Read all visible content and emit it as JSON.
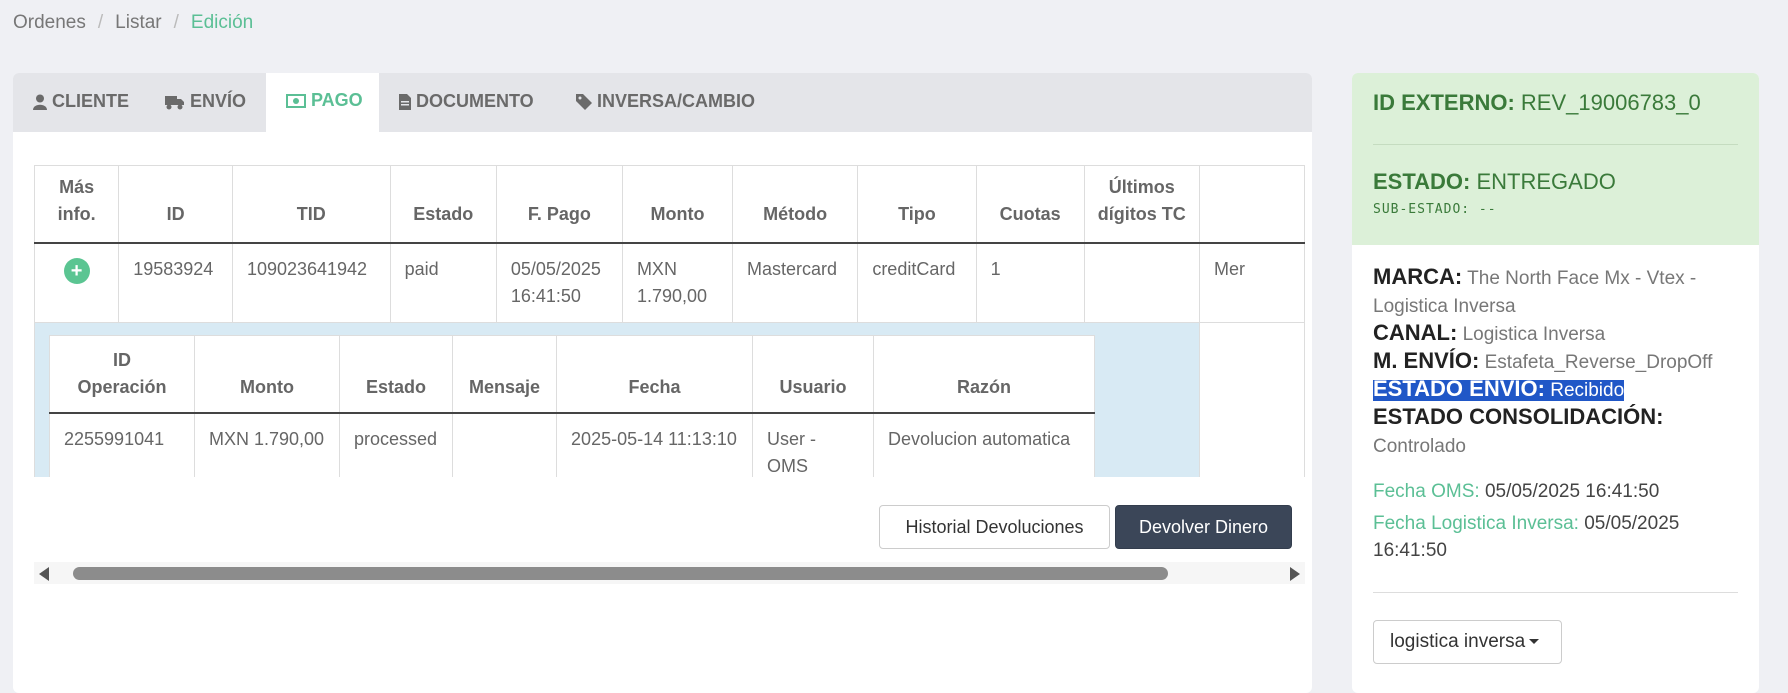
{
  "breadcrumb": {
    "items": [
      "Ordenes",
      "Listar"
    ],
    "active": "Edición"
  },
  "tabs": [
    {
      "label": "CLIENTE",
      "icon": "user-icon"
    },
    {
      "label": "ENVÍO",
      "icon": "truck-icon"
    },
    {
      "label": "PAGO",
      "icon": "money-icon",
      "active": true
    },
    {
      "label": "DOCUMENTO",
      "icon": "file-icon"
    },
    {
      "label": "INVERSA/CAMBIO",
      "icon": "tag-icon"
    }
  ],
  "payments_table": {
    "headers": [
      "Más info.",
      "ID",
      "TID",
      "Estado",
      "F. Pago",
      "Monto",
      "Método",
      "Tipo",
      "Cuotas",
      "Últimos dígitos TC",
      ""
    ],
    "row": {
      "id": "19583924",
      "tid": "109023641942",
      "estado": "paid",
      "fecha_pago_date": "05/05/2025",
      "fecha_pago_time": "16:41:50",
      "monto_currency": "MXN",
      "monto_value": "1.790,00",
      "metodo": "Mastercard",
      "tipo": "creditCard",
      "cuotas": "1",
      "ultimos_digitos": "",
      "extra": "Mer"
    }
  },
  "operations_table": {
    "headers": [
      "ID Operación",
      "Monto",
      "Estado",
      "Mensaje",
      "Fecha",
      "Usuario",
      "Razón"
    ],
    "rows": [
      {
        "id": "2255991041",
        "monto": "MXN 1.790,00",
        "estado": "processed",
        "mensaje": "",
        "fecha": "2025-05-14 11:13:10",
        "usuario": "User - OMS",
        "razon": "Devolucion automatica"
      }
    ]
  },
  "buttons": {
    "historial": "Historial Devoluciones",
    "devolver": "Devolver Dinero"
  },
  "side": {
    "id_externo_label": "ID EXTERNO:",
    "id_externo": "REV_19006783_0",
    "estado_label": "ESTADO:",
    "estado": "ENTREGADO",
    "sub_estado": "SUB-ESTADO: --",
    "marca_label": "MARCA:",
    "marca": "The North Face Mx - Vtex - Logistica Inversa",
    "canal_label": "CANAL:",
    "canal": "Logistica Inversa",
    "m_envio_label": "M. ENVÍO:",
    "m_envio": "Estafeta_Reverse_DropOff",
    "estado_envio_label": "ESTADO ENVÍO:",
    "estado_envio": "Recibido",
    "estado_consolidacion_label": "ESTADO CONSOLIDACIÓN:",
    "estado_consolidacion": "Controlado",
    "fecha_oms_label": "Fecha OMS:",
    "fecha_oms": "05/05/2025 16:41:50",
    "fecha_li_label": "Fecha Logistica Inversa:",
    "fecha_li": "05/05/2025 16:41:50",
    "dropdown": "logistica inversa"
  },
  "colors": {
    "accent": "#5bbf95",
    "dark_button": "#3b4658",
    "success_bg": "#dcf0d8",
    "highlight": "#2057c7"
  }
}
